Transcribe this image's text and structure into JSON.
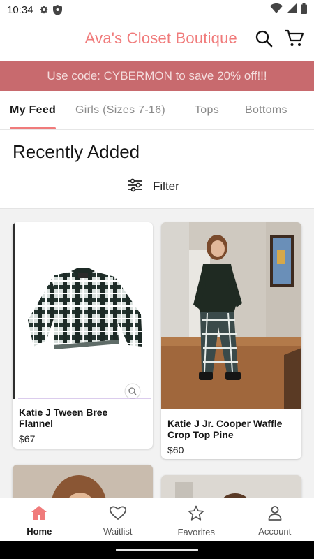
{
  "status_bar": {
    "time": "10:34"
  },
  "header": {
    "brand": "Ava's Closet Boutique"
  },
  "promo": {
    "text": "Use code: CYBERMON to save 20% off!!!"
  },
  "tabs": [
    {
      "label": "My Feed",
      "active": true
    },
    {
      "label": "Girls (Sizes 7-16)",
      "active": false
    },
    {
      "label": "Tops",
      "active": false
    },
    {
      "label": "Bottoms",
      "active": false
    }
  ],
  "section": {
    "title": "Recently Added",
    "filter_label": "Filter"
  },
  "products": [
    {
      "title": "Katie J Tween Bree Flannel",
      "price": "$67"
    },
    {
      "title": "Katie J Jr. Cooper Waffle Crop Top Pine",
      "price": "$60"
    }
  ],
  "bottom_nav": [
    {
      "label": "Home",
      "icon": "home-icon",
      "active": true
    },
    {
      "label": "Waitlist",
      "icon": "heart-icon",
      "active": false
    },
    {
      "label": "Favorites",
      "icon": "star-icon",
      "active": false
    },
    {
      "label": "Account",
      "icon": "account-icon",
      "active": false
    }
  ],
  "colors": {
    "brand": "#f07b7b",
    "promo_bg": "#c86a6e",
    "active_nav": "#f07b7b"
  }
}
